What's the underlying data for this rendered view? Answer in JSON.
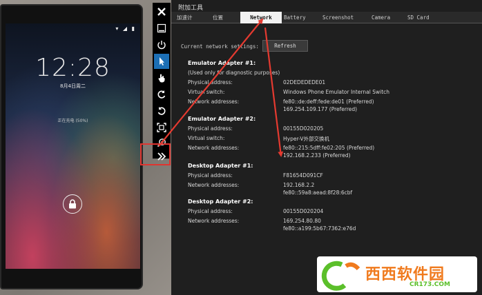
{
  "phone": {
    "status_icons": "▾ ◢ ▮",
    "time": "12:28",
    "date": "8月4日周二",
    "charging": "正在充电 (50%)"
  },
  "toolbar": {
    "buttons": [
      "close-icon",
      "minimize-icon",
      "power-icon",
      "pointer-icon",
      "touch-icon",
      "rotate-left-icon",
      "rotate-right-icon",
      "fit-screen-icon",
      "zoom-icon",
      "additional-tools-icon"
    ]
  },
  "tools": {
    "title": "附加工具",
    "tabs": [
      "加速计",
      "位置",
      "Network",
      "Battery",
      "Screenshot",
      "Camera",
      "SD Card"
    ],
    "active_tab": "Network",
    "current_settings_label": "Current network settings:",
    "refresh_label": "Refresh",
    "adapters": [
      {
        "heading": "Emulator Adapter #1:",
        "note": "(Used only for diagnostic purposes)",
        "rows": [
          {
            "label": "Physical address:",
            "value": "02DEDEDEDE01"
          },
          {
            "label": "Virtual switch:",
            "value": "Windows Phone Emulator Internal Switch"
          },
          {
            "label": "Network addresses:",
            "value": "fe80::de:deff:fede:de01 (Preferred)",
            "value2": "169.254.109.177 (Preferred)"
          }
        ]
      },
      {
        "heading": "Emulator Adapter #2:",
        "rows": [
          {
            "label": "Physical address:",
            "value": "00155D020205"
          },
          {
            "label": "Virtual switch:",
            "value": "Hyper-V外部交换机"
          },
          {
            "label": "Network addresses:",
            "value": "fe80::215:5dff:fe02:205 (Preferred)",
            "value2": "192.168.2.233 (Preferred)"
          }
        ]
      },
      {
        "heading": "Desktop Adapter #1:",
        "rows": [
          {
            "label": "Physical address:",
            "value": "F81654D091CF"
          },
          {
            "label": "Network addresses:",
            "value": "192.168.2.2",
            "value2": "fe80::59a8:aead:8f28:6cbf"
          }
        ]
      },
      {
        "heading": "Desktop Adapter #2:",
        "rows": [
          {
            "label": "Physical address:",
            "value": "00155D020204"
          },
          {
            "label": "Network addresses:",
            "value": "169.254.80.80",
            "value2": "fe80::a199:5b67:7362:e76d"
          }
        ]
      }
    ]
  },
  "watermark": {
    "text": "西西软件园",
    "url": "CR173.COM"
  },
  "colors": {
    "accent_red": "#e0342f",
    "tab_active_bg": "#f2f2f2",
    "toolbar_active": "#1c6fb5"
  }
}
